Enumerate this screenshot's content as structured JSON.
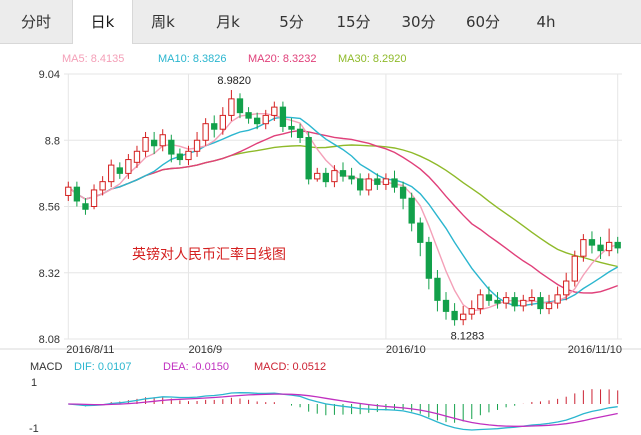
{
  "tabs": [
    "分时",
    "日k",
    "周k",
    "月k",
    "5分",
    "15分",
    "30分",
    "60分",
    "4h"
  ],
  "active_tab": 1,
  "legend": {
    "ma5": {
      "label": "MA5: 8.4135",
      "color": "#f4a0b8"
    },
    "ma10": {
      "label": "MA10: 8.3826",
      "color": "#2bb6cf"
    },
    "ma20": {
      "label": "MA20: 8.3232",
      "color": "#e0407a"
    },
    "ma30": {
      "label": "MA30: 8.2920",
      "color": "#8fba2a"
    }
  },
  "macd_legend": {
    "title": "MACD",
    "dif": {
      "label": "DIF: 0.0107",
      "color": "#2bb6cf"
    },
    "dea": {
      "label": "DEA: -0.0150",
      "color": "#c030c0"
    },
    "macd": {
      "label": "MACD: 0.0512",
      "color": "#cc2233"
    }
  },
  "colors": {
    "up": "#d42020",
    "down": "#12a04a",
    "grid": "#e6e6e6",
    "axis_text": "#333333"
  },
  "chart_data": {
    "type": "candlestick",
    "title": "英镑对人民币汇率日线图",
    "y_ticks": [
      "9.04",
      "8.8",
      "8.56",
      "8.32",
      "8.08"
    ],
    "ylim": [
      8.08,
      9.04
    ],
    "x_ticks": [
      {
        "label": "2016/8/11",
        "index": 0
      },
      {
        "label": "2016/9",
        "index": 14
      },
      {
        "label": "2016/10",
        "index": 37
      },
      {
        "label": "2016/11/10",
        "index": 64
      }
    ],
    "annotations": [
      {
        "label": "8.9820",
        "index": 19,
        "value": 8.982
      },
      {
        "label": "8.1283",
        "index": 45,
        "value": 8.1283
      }
    ],
    "candles": [
      [
        8.6,
        8.63,
        8.58,
        8.65
      ],
      [
        8.63,
        8.58,
        8.56,
        8.65
      ],
      [
        8.57,
        8.55,
        8.53,
        8.59
      ],
      [
        8.56,
        8.62,
        8.55,
        8.64
      ],
      [
        8.62,
        8.65,
        8.6,
        8.67
      ],
      [
        8.65,
        8.71,
        8.63,
        8.73
      ],
      [
        8.7,
        8.68,
        8.66,
        8.72
      ],
      [
        8.68,
        8.73,
        8.66,
        8.75
      ],
      [
        8.72,
        8.76,
        8.7,
        8.78
      ],
      [
        8.76,
        8.81,
        8.74,
        8.83
      ],
      [
        8.8,
        8.78,
        8.75,
        8.83
      ],
      [
        8.78,
        8.82,
        8.76,
        8.84
      ],
      [
        8.8,
        8.75,
        8.72,
        8.82
      ],
      [
        8.75,
        8.73,
        8.71,
        8.77
      ],
      [
        8.73,
        8.76,
        8.71,
        8.78
      ],
      [
        8.76,
        8.8,
        8.74,
        8.83
      ],
      [
        8.8,
        8.86,
        8.78,
        8.88
      ],
      [
        8.86,
        8.84,
        8.81,
        8.89
      ],
      [
        8.84,
        8.89,
        8.82,
        8.92
      ],
      [
        8.89,
        8.95,
        8.87,
        8.982
      ],
      [
        8.95,
        8.9,
        8.88,
        8.97
      ],
      [
        8.9,
        8.88,
        8.86,
        8.92
      ],
      [
        8.88,
        8.86,
        8.84,
        8.9
      ],
      [
        8.86,
        8.89,
        8.84,
        8.91
      ],
      [
        8.89,
        8.92,
        8.87,
        8.94
      ],
      [
        8.92,
        8.85,
        8.83,
        8.94
      ],
      [
        8.85,
        8.84,
        8.81,
        8.88
      ],
      [
        8.84,
        8.81,
        8.79,
        8.86
      ],
      [
        8.81,
        8.66,
        8.64,
        8.83
      ],
      [
        8.66,
        8.68,
        8.65,
        8.7
      ],
      [
        8.68,
        8.65,
        8.63,
        8.7
      ],
      [
        8.65,
        8.69,
        8.63,
        8.71
      ],
      [
        8.69,
        8.67,
        8.65,
        8.72
      ],
      [
        8.67,
        8.66,
        8.64,
        8.7
      ],
      [
        8.66,
        8.62,
        8.6,
        8.68
      ],
      [
        8.62,
        8.66,
        8.6,
        8.68
      ],
      [
        8.66,
        8.64,
        8.62,
        8.68
      ],
      [
        8.64,
        8.66,
        8.62,
        8.68
      ],
      [
        8.66,
        8.63,
        8.61,
        8.69
      ],
      [
        8.63,
        8.59,
        8.55,
        8.65
      ],
      [
        8.59,
        8.5,
        8.47,
        8.61
      ],
      [
        8.5,
        8.43,
        8.38,
        8.52
      ],
      [
        8.43,
        8.3,
        8.26,
        8.45
      ],
      [
        8.3,
        8.22,
        8.18,
        8.33
      ],
      [
        8.22,
        8.18,
        8.15,
        8.25
      ],
      [
        8.18,
        8.15,
        8.1283,
        8.21
      ],
      [
        8.15,
        8.17,
        8.13,
        8.2
      ],
      [
        8.17,
        8.19,
        8.15,
        8.22
      ],
      [
        8.19,
        8.24,
        8.17,
        8.26
      ],
      [
        8.24,
        8.22,
        8.2,
        8.27
      ],
      [
        8.22,
        8.21,
        8.19,
        8.25
      ],
      [
        8.21,
        8.23,
        8.19,
        8.25
      ],
      [
        8.23,
        8.2,
        8.18,
        8.25
      ],
      [
        8.2,
        8.22,
        8.18,
        8.24
      ],
      [
        8.22,
        8.23,
        8.2,
        8.26
      ],
      [
        8.23,
        8.19,
        8.17,
        8.25
      ],
      [
        8.19,
        8.21,
        8.17,
        8.24
      ],
      [
        8.21,
        8.24,
        8.19,
        8.27
      ],
      [
        8.24,
        8.29,
        8.22,
        8.32
      ],
      [
        8.29,
        8.38,
        8.27,
        8.4
      ],
      [
        8.38,
        8.44,
        8.36,
        8.46
      ],
      [
        8.44,
        8.42,
        8.39,
        8.47
      ],
      [
        8.42,
        8.4,
        8.37,
        8.45
      ],
      [
        8.4,
        8.43,
        8.38,
        8.48
      ],
      [
        8.43,
        8.41,
        8.39,
        8.45
      ]
    ]
  }
}
